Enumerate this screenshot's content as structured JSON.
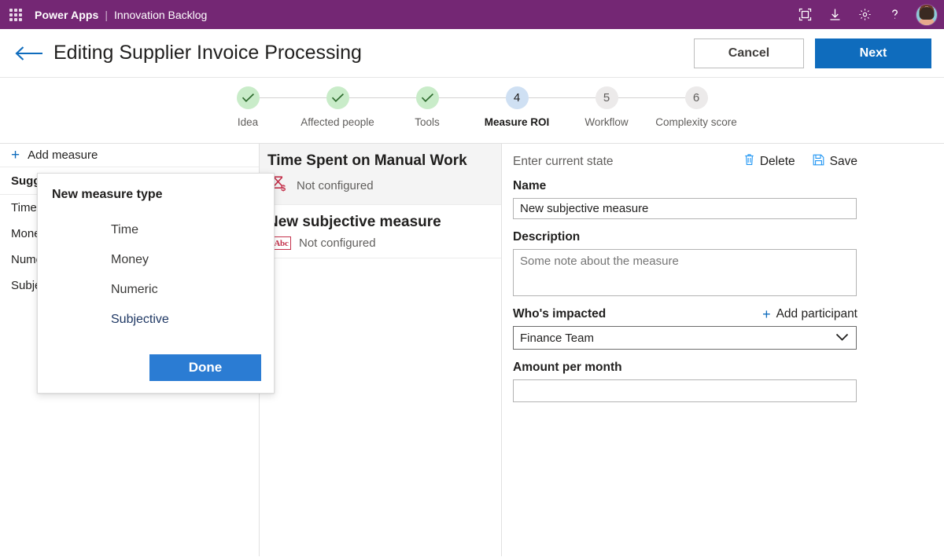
{
  "suitebar": {
    "waffle_icon": "app-launcher-icon",
    "app_name": "Power Apps",
    "separator": "|",
    "context_name": "Innovation Backlog",
    "icons": [
      {
        "name": "screen-fit-icon",
        "label": "Screen fit"
      },
      {
        "name": "download-icon",
        "label": "Download"
      },
      {
        "name": "gear-icon",
        "label": "Settings"
      },
      {
        "name": "help-icon",
        "label": "Help"
      }
    ],
    "avatar_name": "user-avatar",
    "brand_color": "#742774"
  },
  "commandbar": {
    "back_icon": "back-arrow-icon",
    "title": "Editing Supplier Invoice Processing",
    "cancel_label": "Cancel",
    "next_label": "Next",
    "primary_color": "#0f6cbd"
  },
  "stepper": {
    "steps": [
      {
        "number": "1",
        "label": "Idea",
        "state": "done",
        "mark": "check"
      },
      {
        "number": "2",
        "label": "Affected people",
        "state": "done",
        "mark": "check"
      },
      {
        "number": "3",
        "label": "Tools",
        "state": "done",
        "mark": "check"
      },
      {
        "number": "4",
        "label": "Measure ROI",
        "state": "active",
        "mark": "4"
      },
      {
        "number": "5",
        "label": "Workflow",
        "state": "upcoming",
        "mark": "5"
      },
      {
        "number": "6",
        "label": "Complexity score",
        "state": "upcoming",
        "mark": "6"
      }
    ],
    "done_color": "#c9ecc9",
    "active_color": "#cfe0f3"
  },
  "left_panel": {
    "add_measure_label": "Add measure",
    "add_icon": "plus-icon",
    "suggested_header": "Suggested",
    "suggested_items": [
      "Time",
      "Money",
      "Numeric",
      "Subjective"
    ]
  },
  "popup": {
    "title": "New measure type",
    "options": [
      {
        "label": "Time",
        "selected": false
      },
      {
        "label": "Money",
        "selected": false
      },
      {
        "label": "Numeric",
        "selected": false
      },
      {
        "label": "Subjective",
        "selected": true
      }
    ],
    "done_label": "Done",
    "done_color": "#2b7cd3"
  },
  "measures": [
    {
      "title": "Time Spent on Manual Work",
      "status": "Not configured",
      "icon": "hourglass-money-icon",
      "selected": true
    },
    {
      "title": "New subjective measure",
      "status": "Not configured",
      "icon": "abc-text-icon",
      "selected": false
    }
  ],
  "detail": {
    "state_text": "Enter current state",
    "delete_label": "Delete",
    "delete_icon": "trash-icon",
    "save_label": "Save",
    "save_icon": "save-disk-icon",
    "name_label": "Name",
    "name_value": "New subjective measure",
    "description_label": "Description",
    "description_placeholder": "Some note about the measure",
    "description_value": "",
    "impacted_label": "Who's impacted",
    "add_participant_label": "Add participant",
    "add_participant_icon": "plus-icon",
    "participant_value": "Finance Team",
    "participant_options": [
      "Finance Team"
    ],
    "amount_label": "Amount per month",
    "amount_value": "",
    "chevron_icon": "chevron-down-icon"
  }
}
